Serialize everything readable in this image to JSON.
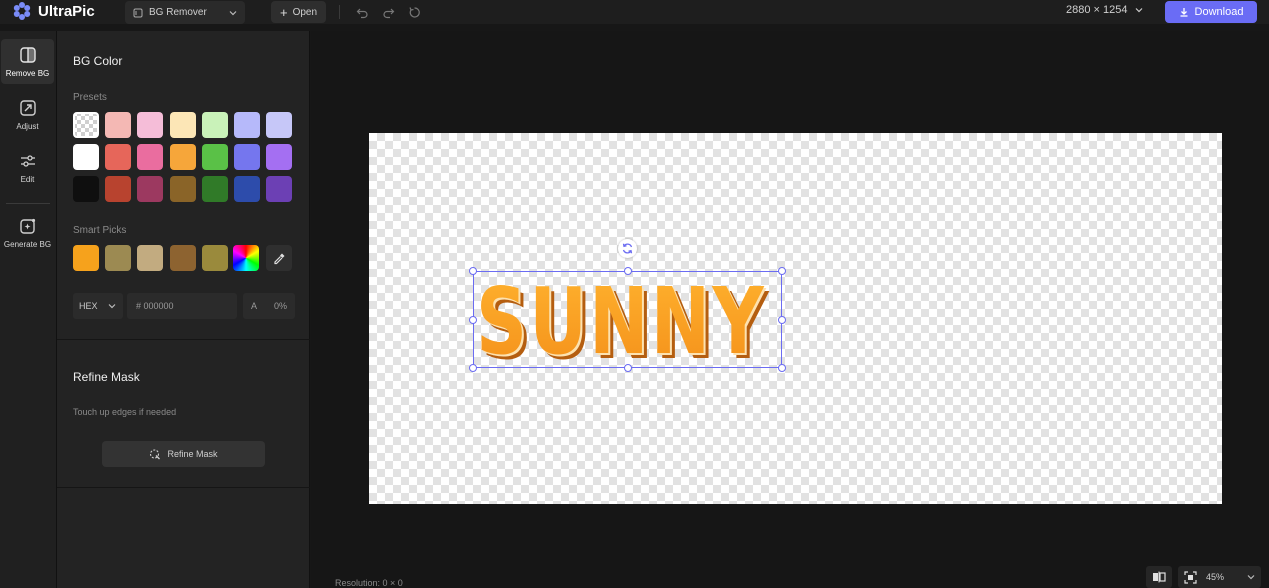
{
  "app": {
    "title": "UltraPic",
    "tool_select": "BG Remover",
    "open_label": "Open",
    "dimensions": "2880 × 1254",
    "download_label": "Download",
    "accent": "#6a6cf5"
  },
  "rail": {
    "items": [
      {
        "label": "Remove BG",
        "icon": "remove-bg-icon",
        "active": true
      },
      {
        "label": "Adjust",
        "icon": "adjust-icon"
      },
      {
        "label": "Edit",
        "icon": "sliders-icon"
      },
      {
        "label": "Generate BG",
        "icon": "sparkle-image-icon"
      }
    ]
  },
  "bg_color": {
    "title": "BG Color",
    "presets_label": "Presets",
    "presets": [
      [
        "transparent",
        "#f4b8b4",
        "#f5bdd8",
        "#fce6b6",
        "#c9f2b9",
        "#b6b9fa",
        "#c6c7f8"
      ],
      [
        "#ffffff",
        "#e6665a",
        "#ea6d9f",
        "#f6a63a",
        "#5ac147",
        "#7576ee",
        "#a46ff2"
      ],
      [
        "#0f0f0f",
        "#b8432f",
        "#9c3960",
        "#8a6428",
        "#307a28",
        "#2d4cab",
        "#6c40b4"
      ]
    ],
    "smart_picks_label": "Smart Picks",
    "smart_picks": [
      "#f6a21c",
      "#9c8a52",
      "#c2ab80",
      "#8d6330",
      "#9a8a3c"
    ],
    "format": "HEX",
    "hex_value": "# 000000",
    "alpha_label": "A",
    "alpha_value": "0%"
  },
  "refine": {
    "title": "Refine Mask",
    "hint": "Touch up edges if needed",
    "button_label": "Refine Mask"
  },
  "canvas": {
    "word": "SUNNY",
    "resolution": "Resolution: 0 × 0",
    "zoom": "45%"
  }
}
